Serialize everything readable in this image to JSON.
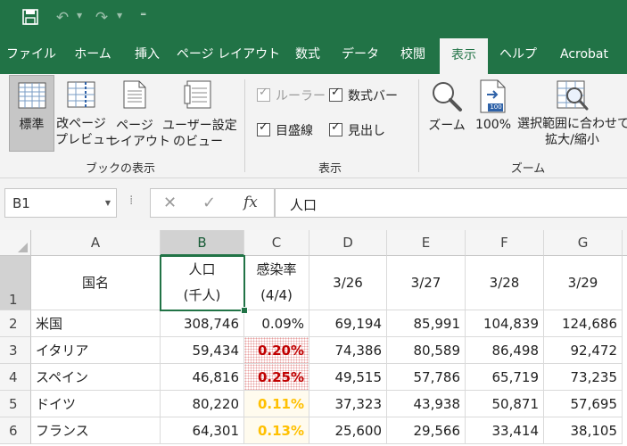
{
  "colors": {
    "brand": "#217346",
    "text_red": "#c00000",
    "text_yellow": "#ffc000"
  },
  "quick_access": {
    "save_icon": "save-icon",
    "undo_icon": "undo-icon",
    "redo_icon": "redo-icon",
    "customize_icon": "customize-icon"
  },
  "tabs": [
    "ファイル",
    "ホーム",
    "挿入",
    "ページ レイアウト",
    "数式",
    "データ",
    "校閲",
    "表示",
    "ヘルプ",
    "Acrobat"
  ],
  "active_tab": "表示",
  "ribbon": {
    "workbook_views": {
      "label": "ブックの表示",
      "normal": "標準",
      "page_break_1": "改ページ",
      "page_break_2": "プレビュー",
      "page_layout_1": "ページ",
      "page_layout_2": "レイアウト",
      "custom_views_1": "ユーザー設定",
      "custom_views_2": "のビュー"
    },
    "show": {
      "label": "表示",
      "ruler": "ルーラー",
      "formula_bar": "数式バー",
      "gridlines": "目盛線",
      "headings": "見出し"
    },
    "zoom": {
      "label": "ズーム",
      "zoom": "ズーム",
      "hundred": "100%",
      "hundred_icon_text": "100",
      "fit_1": "選択範囲に合わせて",
      "fit_2": "拡大/縮小"
    }
  },
  "formula_bar": {
    "name_box": "B1",
    "content": "人口"
  },
  "sheet": {
    "columns": [
      "A",
      "B",
      "C",
      "D",
      "E",
      "F",
      "G"
    ],
    "row_numbers": [
      "1",
      "2",
      "3",
      "4",
      "5",
      "6"
    ],
    "header_row": {
      "a": "国名",
      "b1": "人口",
      "b2": "(千人)",
      "c1": "感染率",
      "c2": "(4/4)",
      "d": "3/26",
      "e": "3/27",
      "f": "3/28",
      "g": "3/29"
    },
    "rows": [
      [
        "米国",
        "308,746",
        "0.09%",
        "69,194",
        "85,991",
        "104,839",
        "124,686"
      ],
      [
        "イタリア",
        "59,434",
        "0.20%",
        "74,386",
        "80,589",
        "86,498",
        "92,472"
      ],
      [
        "スペイン",
        "46,816",
        "0.25%",
        "49,515",
        "57,786",
        "65,719",
        "73,235"
      ],
      [
        "ドイツ",
        "80,220",
        "0.11%",
        "37,323",
        "43,938",
        "50,871",
        "57,695"
      ],
      [
        "フランス",
        "64,301",
        "0.13%",
        "25,600",
        "29,566",
        "33,414",
        "38,105"
      ]
    ]
  }
}
